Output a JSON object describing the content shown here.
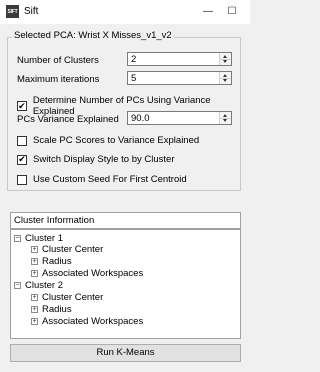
{
  "window": {
    "icon_label": "SIFT",
    "title": "Sift",
    "minimize_glyph": "—",
    "maximize_glyph": "☐"
  },
  "group": {
    "title": "Selected PCA:  Wrist X Misses_v1_v2",
    "number_of_clusters_label": "Number of Clusters",
    "number_of_clusters_value": "2",
    "max_iterations_label": "Maximum iterations",
    "max_iterations_value": "5",
    "determine_pcs_label": "Determine Number of PCs Using Variance Explained",
    "determine_pcs_checked": true,
    "pcs_variance_label": "PCs Variance Explained",
    "pcs_variance_value": "90.0",
    "scale_pc_label": "Scale PC Scores to Variance Explained",
    "scale_pc_checked": false,
    "switch_display_label": "Switch Display Style to by Cluster",
    "switch_display_checked": true,
    "custom_seed_label": "Use Custom Seed For First Centroid",
    "custom_seed_checked": false
  },
  "cluster_info": {
    "header": "Cluster Information",
    "expanded_glyph": "−",
    "collapsed_glyph": "+",
    "clusters": [
      {
        "label": "Cluster 1",
        "children": [
          "Cluster Center",
          "Radius",
          "Associated Workspaces"
        ]
      },
      {
        "label": "Cluster 2",
        "children": [
          "Cluster Center",
          "Radius",
          "Associated Workspaces"
        ]
      }
    ]
  },
  "run_button": "Run K-Means"
}
